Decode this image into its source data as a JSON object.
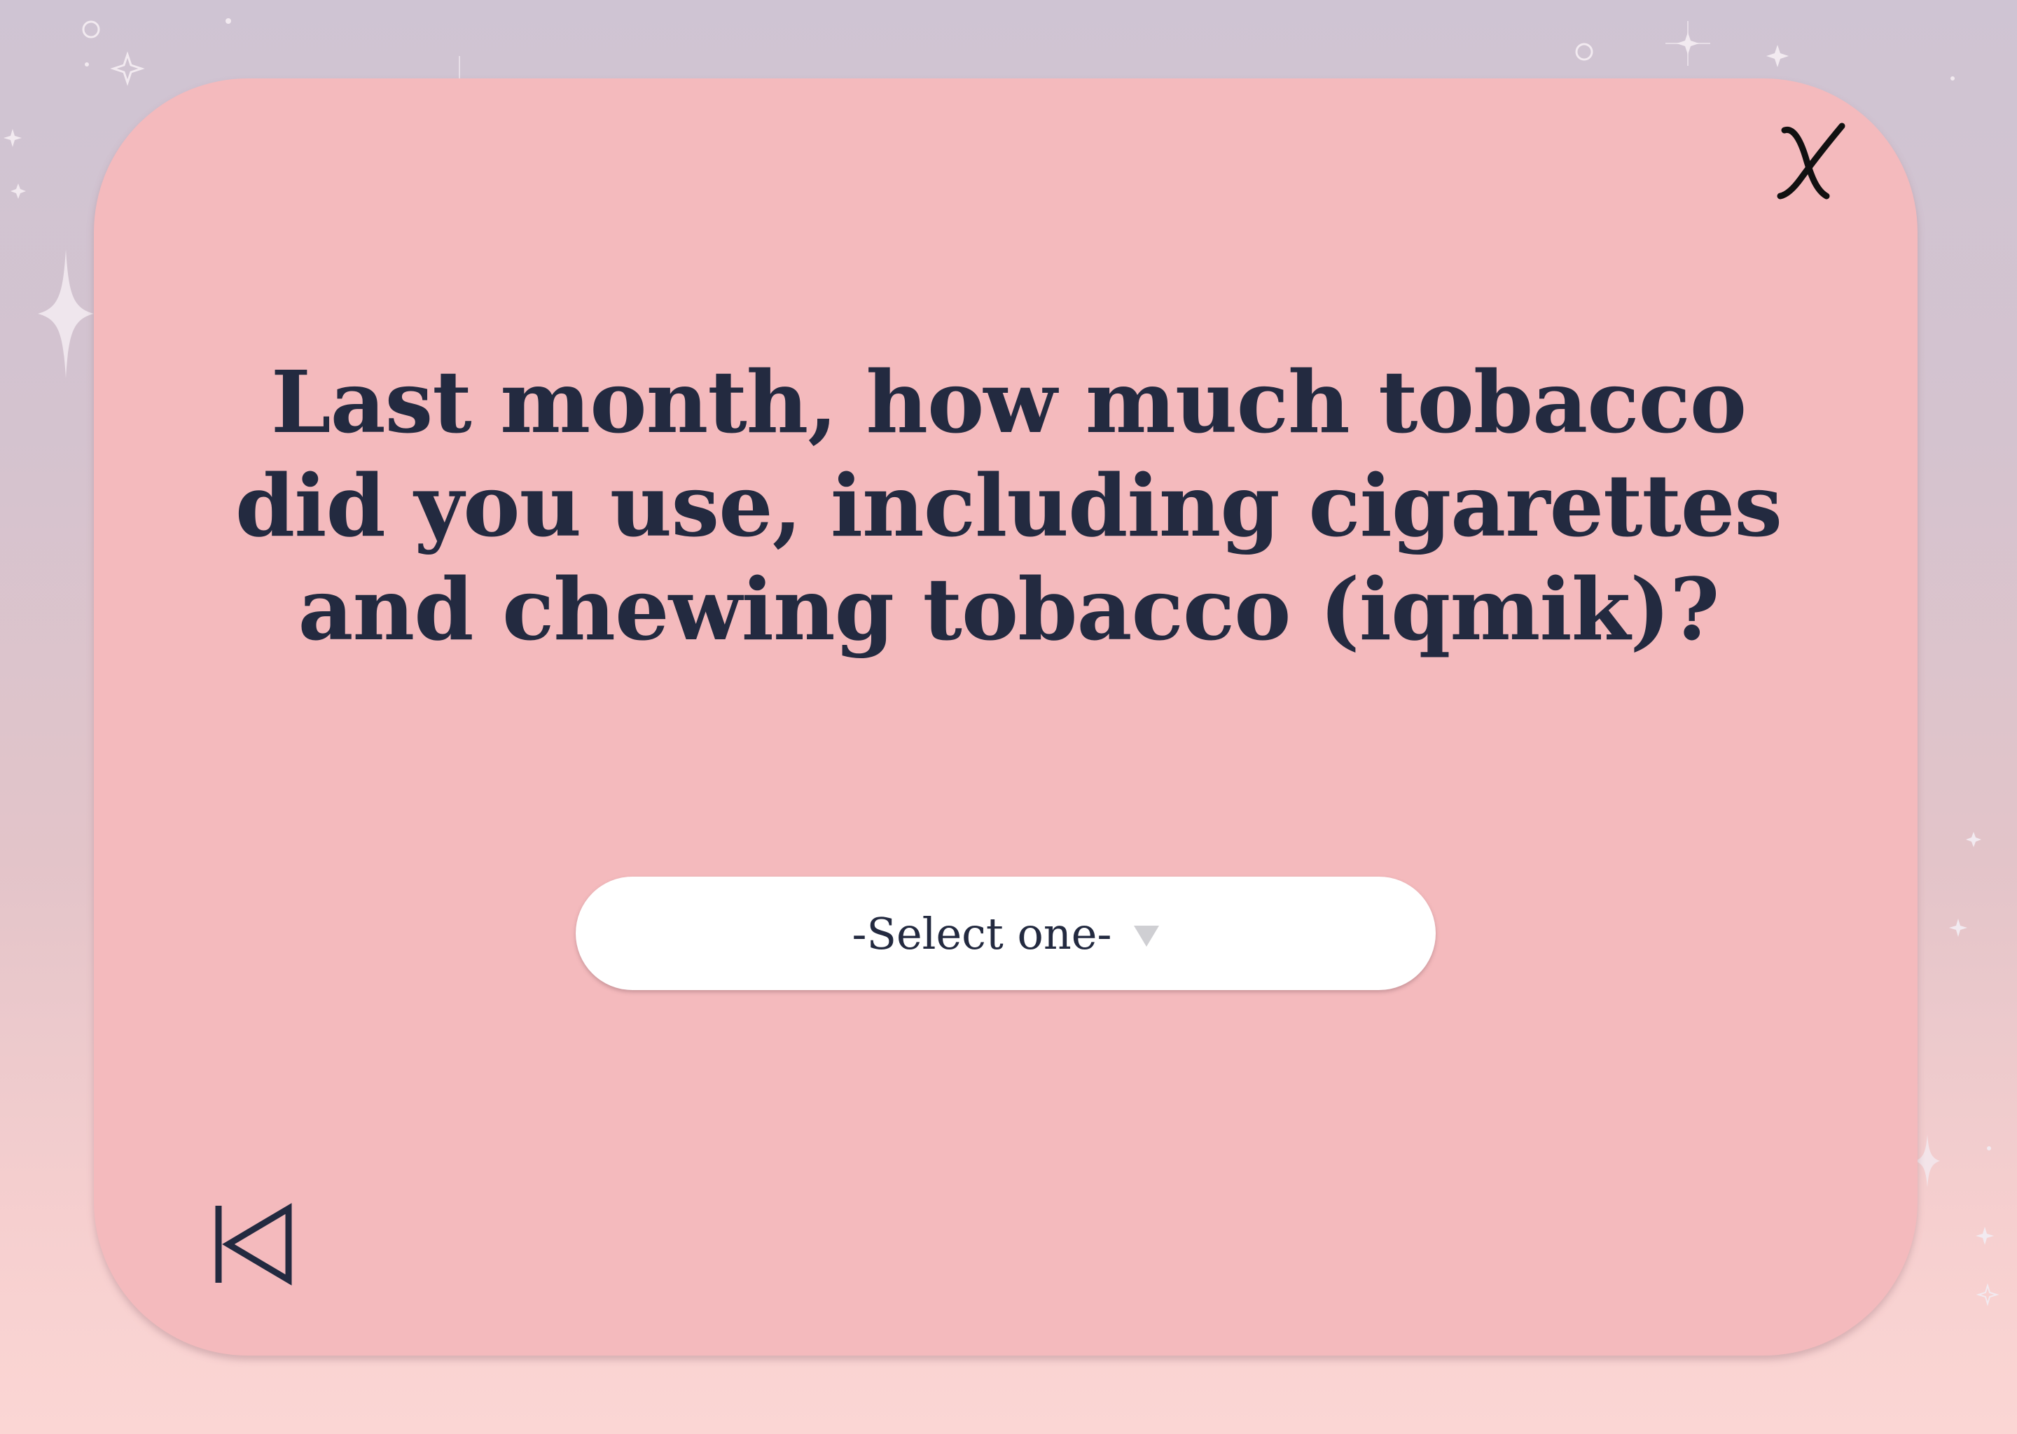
{
  "question": {
    "text": "Last month, how much tobacco did you use, including cigarettes and chewing tobacco (iqmik)?"
  },
  "dropdown": {
    "selected": "-Select one-"
  },
  "icons": {
    "close": "close-icon",
    "back": "skip-back-icon",
    "dropdown": "chevron-down-icon"
  },
  "colors": {
    "card_background": "#f4babd",
    "text": "#232a40",
    "select_background": "#ffffff",
    "arrow": "#cfcfd3"
  }
}
